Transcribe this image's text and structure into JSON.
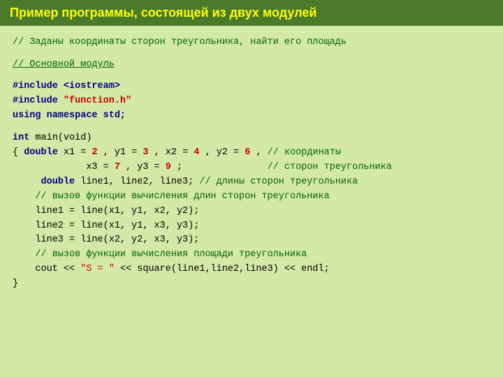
{
  "title": "Пример программы, состоящей из двух модулей",
  "lines": [
    {
      "type": "comment",
      "text": "// Заданы координаты сторон треугольника, найти его площадь"
    },
    {
      "type": "blank"
    },
    {
      "type": "comment-underline",
      "text": "// Основной модуль"
    },
    {
      "type": "blank"
    },
    {
      "type": "directive",
      "text": "#include <iostream>"
    },
    {
      "type": "directive2",
      "text": "#include \"function.h\""
    },
    {
      "type": "keyword-line",
      "text": "using namespace std;"
    },
    {
      "type": "blank"
    },
    {
      "type": "code",
      "text": "int main(void)"
    },
    {
      "type": "code-complex",
      "id": "brace-line"
    },
    {
      "type": "code-complex2",
      "id": "x3-line"
    },
    {
      "type": "code-complex3",
      "id": "double-line"
    },
    {
      "type": "comment-full",
      "text": "    // вызов функции вычисления длин сторон треугольника"
    },
    {
      "type": "code",
      "text": "    line1 = line(x1, y1, x2, y2);"
    },
    {
      "type": "code",
      "text": "    line2 = line(x1, y1, x3, y3);"
    },
    {
      "type": "code",
      "text": "    line3 = line(x2, y2, x3, y3);"
    },
    {
      "type": "comment-full",
      "text": "    // вызов функции вычисления площади треугольника"
    },
    {
      "type": "cout-line",
      "id": "cout-line"
    },
    {
      "type": "code",
      "text": "}"
    }
  ]
}
